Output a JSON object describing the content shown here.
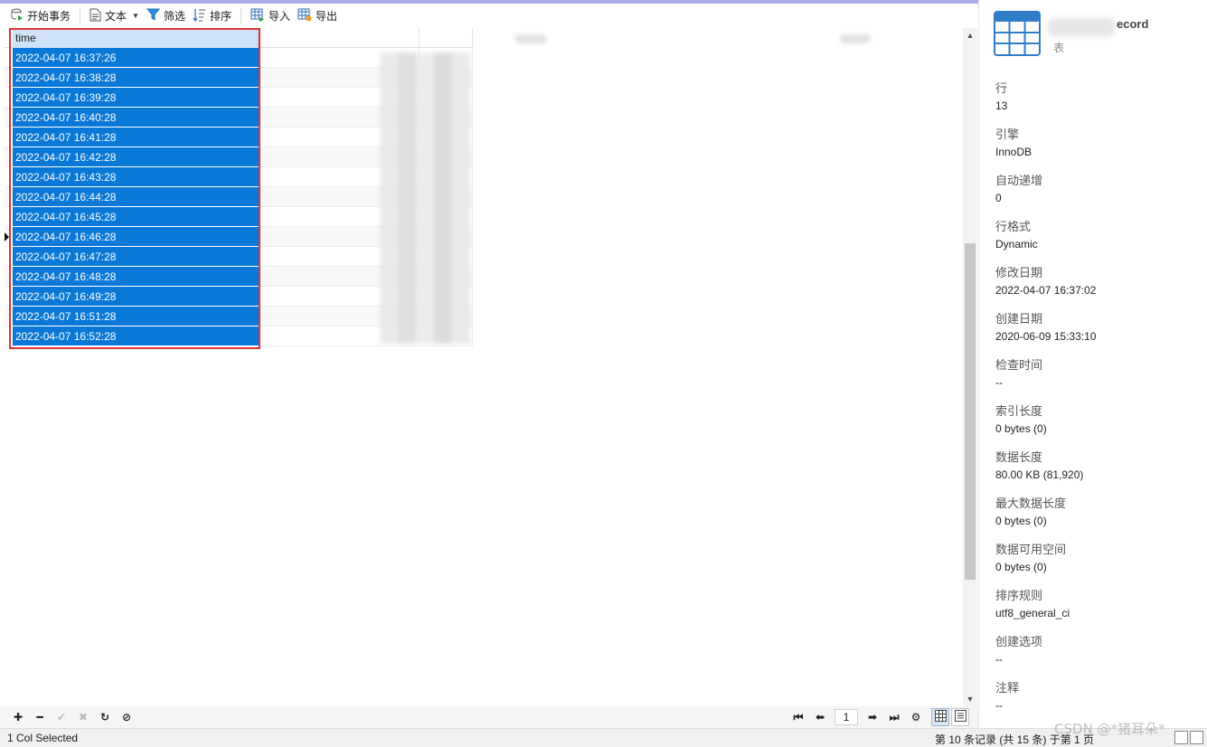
{
  "toolbar": {
    "begin_transaction": "开始事务",
    "text": "文本",
    "filter": "筛选",
    "sort": "排序",
    "import": "导入",
    "export": "导出"
  },
  "grid": {
    "column": "time",
    "rows": [
      "2022-04-07 16:37:26",
      "2022-04-07 16:38:28",
      "2022-04-07 16:39:28",
      "2022-04-07 16:40:28",
      "2022-04-07 16:41:28",
      "2022-04-07 16:42:28",
      "2022-04-07 16:43:28",
      "2022-04-07 16:44:28",
      "2022-04-07 16:45:28",
      "2022-04-07 16:46:28",
      "2022-04-07 16:47:28",
      "2022-04-07 16:48:28",
      "2022-04-07 16:49:28",
      "2022-04-07 16:51:28",
      "2022-04-07 16:52:28"
    ]
  },
  "pager": {
    "page": "1"
  },
  "status": {
    "selection": "1 Col Selected",
    "records": "第 10 条记录 (共 15 条) 于第 1 页"
  },
  "watermark": "CSDN @*猪耳朵*",
  "panel": {
    "name_suffix": "ecord",
    "type": "表",
    "properties": [
      {
        "label": "行",
        "value": "13"
      },
      {
        "label": "引擎",
        "value": "InnoDB"
      },
      {
        "label": "自动递增",
        "value": "0"
      },
      {
        "label": "行格式",
        "value": "Dynamic"
      },
      {
        "label": "修改日期",
        "value": "2022-04-07 16:37:02"
      },
      {
        "label": "创建日期",
        "value": "2020-06-09 15:33:10"
      },
      {
        "label": "检查时间",
        "value": "--"
      },
      {
        "label": "索引长度",
        "value": "0 bytes (0)"
      },
      {
        "label": "数据长度",
        "value": "80.00 KB (81,920)"
      },
      {
        "label": "最大数据长度",
        "value": "0 bytes (0)"
      },
      {
        "label": "数据可用空间",
        "value": "0 bytes (0)"
      },
      {
        "label": "排序规则",
        "value": "utf8_general_ci"
      },
      {
        "label": "创建选项",
        "value": "--"
      },
      {
        "label": "注释",
        "value": "--"
      }
    ]
  },
  "colors": {
    "selection": "#0a78d7",
    "header_selected": "#cfe2f7",
    "highlight_frame": "#e03434",
    "accent_bar": "#a8a9e6"
  }
}
